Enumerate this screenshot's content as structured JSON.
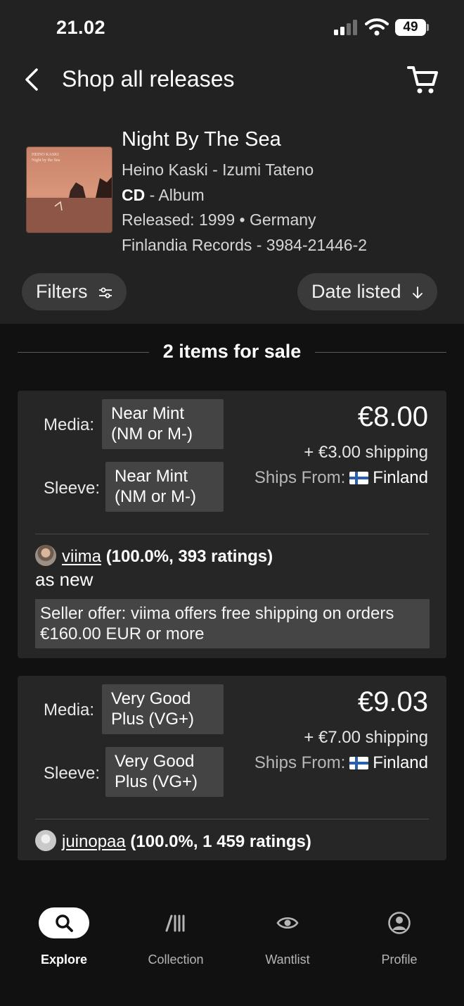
{
  "status_bar": {
    "time": "21.02",
    "battery": "49"
  },
  "header": {
    "title": "Shop all releases",
    "back_icon": "chevron-left-icon",
    "cart_icon": "cart-icon"
  },
  "release": {
    "title": "Night By The Sea",
    "artists": "Heino Kaski - Izumi Tateno",
    "format_bold": "CD",
    "format_rest": " - Album",
    "released": "Released: 1999 • Germany",
    "label_catalog": "Finlandia Records - 3984-21446-2",
    "cover_text": {
      "artist": "HEINO KASKI",
      "title": "Night by the Sea"
    }
  },
  "controls": {
    "filters_label": "Filters",
    "sort_label": "Date listed"
  },
  "listing_count": "2 items for sale",
  "listings": [
    {
      "media_label": "Media:",
      "media_condition": "Near Mint (NM or M-)",
      "sleeve_label": "Sleeve:",
      "sleeve_condition": "Near Mint (NM or M-)",
      "price": "€8.00",
      "shipping": "+ €3.00 shipping",
      "ships_from_label": "Ships From:",
      "ships_from_country": "Finland",
      "seller_name": "viima",
      "seller_rating": "(100.0%, 393 ratings)",
      "comment": "as new",
      "seller_offer": "Seller offer: viima offers free shipping on orders €160.00 EUR or more"
    },
    {
      "media_label": "Media:",
      "media_condition": "Very Good Plus (VG+)",
      "sleeve_label": "Sleeve:",
      "sleeve_condition": "Very Good Plus (VG+)",
      "price": "€9.03",
      "shipping": "+ €7.00 shipping",
      "ships_from_label": "Ships From:",
      "ships_from_country": "Finland",
      "seller_name": "juinopaa",
      "seller_rating": "(100.0%, 1 459 ratings)"
    }
  ],
  "tabs": [
    {
      "label": "Explore",
      "icon": "search-icon",
      "active": true
    },
    {
      "label": "Collection",
      "icon": "collection-icon"
    },
    {
      "label": "Wantlist",
      "icon": "eye-icon"
    },
    {
      "label": "Profile",
      "icon": "profile-icon"
    }
  ]
}
